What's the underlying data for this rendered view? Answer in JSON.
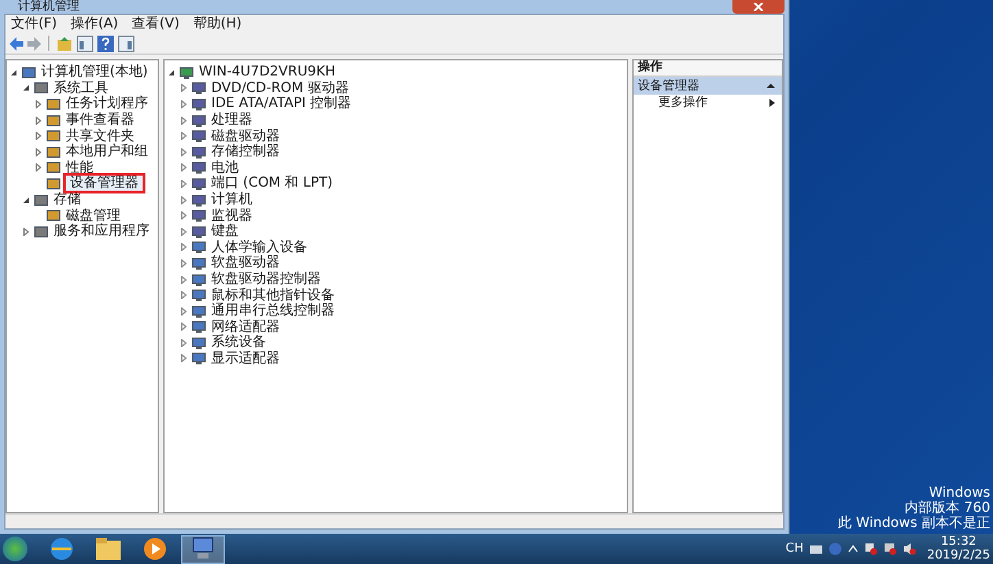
{
  "window": {
    "title": "计算机管理"
  },
  "menu": [
    "文件(F)",
    "操作(A)",
    "查看(V)",
    "帮助(H)"
  ],
  "nav_tree": [
    {
      "label": "计算机管理(本地)",
      "expanded": true,
      "selected": false,
      "children": [
        {
          "label": "系统工具",
          "expanded": true,
          "selected": false,
          "children": [
            {
              "label": "任务计划程序",
              "expanded": false,
              "selected": false
            },
            {
              "label": "事件查看器",
              "expanded": false,
              "selected": false
            },
            {
              "label": "共享文件夹",
              "expanded": false,
              "selected": false
            },
            {
              "label": "本地用户和组",
              "expanded": false,
              "selected": false
            },
            {
              "label": "性能",
              "expanded": false,
              "selected": false
            },
            {
              "label": "设备管理器",
              "selected": true
            }
          ]
        },
        {
          "label": "存储",
          "expanded": true,
          "selected": false,
          "children": [
            {
              "label": "磁盘管理",
              "selected": false
            }
          ]
        },
        {
          "label": "服务和应用程序",
          "expanded": false,
          "selected": false
        }
      ]
    }
  ],
  "device_tree": [
    {
      "label": "WIN-4U7D2VRU9KH",
      "expanded": true,
      "children": [
        {
          "label": "DVD/CD-ROM 驱动器",
          "expanded": false
        },
        {
          "label": "IDE ATA/ATAPI 控制器",
          "expanded": false
        },
        {
          "label": "处理器",
          "expanded": false
        },
        {
          "label": "磁盘驱动器",
          "expanded": false
        },
        {
          "label": "存储控制器",
          "expanded": false
        },
        {
          "label": "电池",
          "expanded": false
        },
        {
          "label": "端口 (COM 和 LPT)",
          "expanded": false
        },
        {
          "label": "计算机",
          "expanded": false
        },
        {
          "label": "监视器",
          "expanded": false
        },
        {
          "label": "键盘",
          "expanded": false
        },
        {
          "label": "人体学输入设备",
          "expanded": false
        },
        {
          "label": "软盘驱动器",
          "expanded": false
        },
        {
          "label": "软盘驱动器控制器",
          "expanded": false
        },
        {
          "label": "鼠标和其他指针设备",
          "expanded": false
        },
        {
          "label": "通用串行总线控制器",
          "expanded": false
        },
        {
          "label": "网络适配器",
          "expanded": false
        },
        {
          "label": "系统设备",
          "expanded": false
        },
        {
          "label": "显示适配器",
          "expanded": false
        }
      ]
    }
  ],
  "actions": {
    "header": "操作",
    "section": {
      "label": "设备管理器",
      "expanded": true
    },
    "items": [
      "更多操作"
    ]
  },
  "desktop_notice": [
    "Windows",
    "内部版本 760",
    "此 Windows 副本不是正"
  ],
  "taskbar": {
    "language": "CH",
    "time": "15:32",
    "date": "2019/2/25"
  }
}
